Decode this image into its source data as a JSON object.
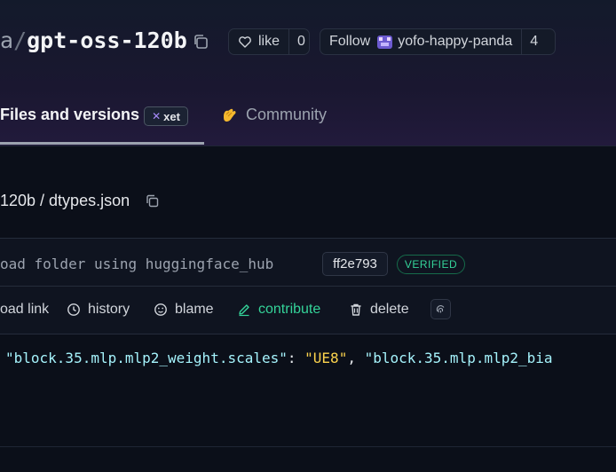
{
  "repo": {
    "owner_fragment": "a",
    "separator": "/",
    "name": "gpt-oss-120b"
  },
  "like": {
    "label": "like",
    "count": "0"
  },
  "follow": {
    "label": "Follow",
    "org": "yofo-happy-panda",
    "count": "4"
  },
  "tabs": {
    "files": "Files and versions",
    "xet_badge": "xet",
    "community": "Community"
  },
  "breadcrumb": "120b / dtypes.json",
  "commit": {
    "message": "oad folder using huggingface_hub",
    "sha": "ff2e793",
    "verified": "VERIFIED"
  },
  "actions": {
    "download": "oad link",
    "history": "history",
    "blame": "blame",
    "contribute": "contribute",
    "delete": "delete"
  },
  "code": {
    "key1": "\"block.35.mlp.mlp2_weight.scales\"",
    "colon": ": ",
    "value1": "\"UE8\"",
    "comma": ", ",
    "key2": "\"block.35.mlp.mlp2_bia"
  },
  "colors": {
    "background": "#0b0f19",
    "accent_green": "#34d399",
    "code_key": "#a5f3fc",
    "code_string": "#fcd34d"
  }
}
